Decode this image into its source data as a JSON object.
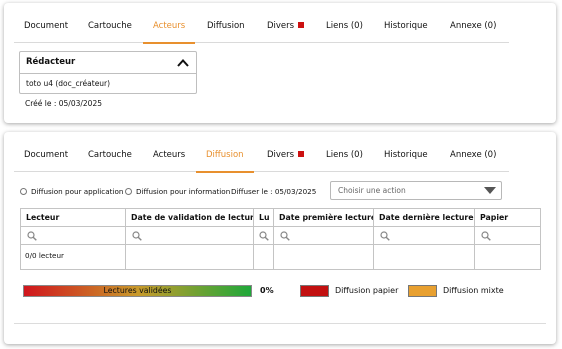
{
  "tabs_top": [
    {
      "label": "Document"
    },
    {
      "label": "Cartouche"
    },
    {
      "label": "Acteurs",
      "active": true
    },
    {
      "label": "Diffusion"
    },
    {
      "label": "Divers",
      "dot": true
    },
    {
      "label": "Liens (0)"
    },
    {
      "label": "Historique"
    },
    {
      "label": "Annexe (0)"
    }
  ],
  "redacteur": {
    "title": "Rédacteur",
    "name": "toto u4 (doc_créateur)",
    "chevron_icon": "chevron-up-icon"
  },
  "created": "Créé le :  05/03/2025",
  "tabs_bottom": [
    {
      "label": "Document"
    },
    {
      "label": "Cartouche"
    },
    {
      "label": "Acteurs"
    },
    {
      "label": "Diffusion",
      "active": true
    },
    {
      "label": "Divers",
      "dot": true
    },
    {
      "label": "Liens (0)"
    },
    {
      "label": "Historique"
    },
    {
      "label": "Annexe (0)"
    }
  ],
  "diffusion": {
    "option_application": "Diffusion pour application",
    "option_information": "Diffusion pour information",
    "diffuser_le": "Diffuser le : 05/03/2025",
    "action_placeholder": "Choisir une action"
  },
  "table": {
    "columns": [
      "Lecteur",
      "Date de validation de lecture",
      "Lu",
      "Date première lecture",
      "Date dernière lecture",
      "Papier"
    ],
    "filter_icon": "search-icon",
    "row_text": "0/0 lecteur"
  },
  "legend": {
    "progress_label": "Lectures validées",
    "progress_value": "0%",
    "paper": "Diffusion papier",
    "mixed": "Diffusion mixte"
  },
  "colors": {
    "accent": "#e8902e",
    "dot": "#cc1111",
    "paper_swatch": "#c21010",
    "mixed_swatch": "#e8a030"
  }
}
